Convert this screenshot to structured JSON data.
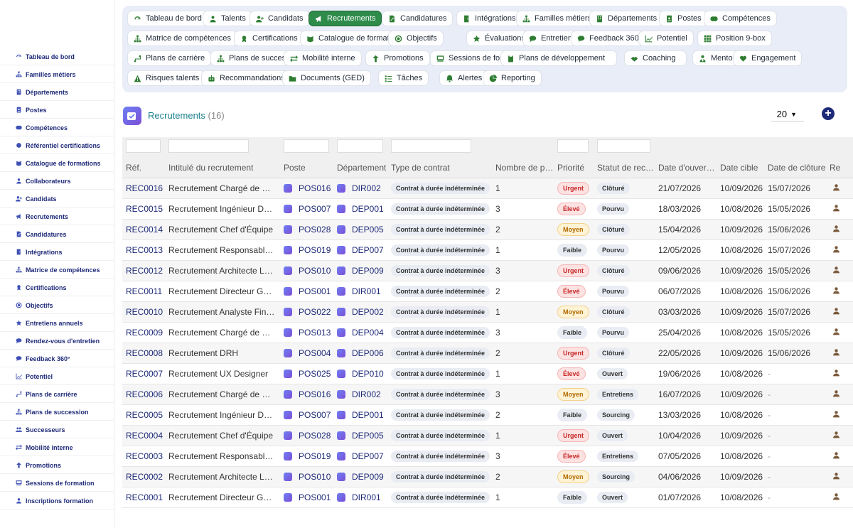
{
  "sidebar": {
    "items": [
      {
        "label": "Tableau de bord",
        "icon": "dashboard-icon"
      },
      {
        "label": "Familles métiers",
        "icon": "sitemap-icon"
      },
      {
        "label": "Départements",
        "icon": "building-icon"
      },
      {
        "label": "Postes",
        "icon": "id-badge-icon"
      },
      {
        "label": "Compétences",
        "icon": "brain-icon"
      },
      {
        "label": "Référentiel certifications",
        "icon": "certificate-icon"
      },
      {
        "label": "Catalogue de formations",
        "icon": "book-icon"
      },
      {
        "label": "Collaborateurs",
        "icon": "user-icon"
      },
      {
        "label": "Candidats",
        "icon": "user-plus-icon"
      },
      {
        "label": "Recrutements",
        "icon": "megaphone-icon"
      },
      {
        "label": "Candidatures",
        "icon": "file-signature-icon"
      },
      {
        "label": "Intégrations",
        "icon": "door-icon"
      },
      {
        "label": "Matrice de compétences",
        "icon": "sitemap-icon"
      },
      {
        "label": "Certifications",
        "icon": "award-icon"
      },
      {
        "label": "Objectifs",
        "icon": "target-icon"
      },
      {
        "label": "Entretiens annuels",
        "icon": "star-icon"
      },
      {
        "label": "Rendez-vous d'entretien",
        "icon": "chat-icon"
      },
      {
        "label": "Feedback 360°",
        "icon": "comment-icon"
      },
      {
        "label": "Potentiel",
        "icon": "chart-line-icon"
      },
      {
        "label": "Plans de carrière",
        "icon": "route-icon"
      },
      {
        "label": "Plans de succession",
        "icon": "sitemap-icon"
      },
      {
        "label": "Successeurs",
        "icon": "users-icon"
      },
      {
        "label": "Mobilité interne",
        "icon": "exchange-icon"
      },
      {
        "label": "Promotions",
        "icon": "arrow-up-icon"
      },
      {
        "label": "Sessions de formation",
        "icon": "chalkboard-icon"
      },
      {
        "label": "Inscriptions formation",
        "icon": "user-icon"
      }
    ]
  },
  "topnav": {
    "rows": [
      [
        {
          "label": "Tableau de bord",
          "icon": "dashboard-icon"
        },
        {
          "label": "Talents",
          "icon": "user-icon"
        },
        {
          "label": "Candidats",
          "icon": "user-plus-icon"
        },
        {
          "label": "Recrutements",
          "icon": "megaphone-icon",
          "active": true
        },
        {
          "label": "Candidatures",
          "icon": "file-signature-icon"
        },
        {
          "label": "Intégrations",
          "icon": "door-icon"
        },
        {
          "label": "Familles métiers",
          "icon": "sitemap-icon"
        },
        {
          "label": "Départements",
          "icon": "building-icon"
        },
        {
          "label": "Postes",
          "icon": "id-badge-icon"
        },
        {
          "label": "Compétences",
          "icon": "brain-icon"
        }
      ],
      [
        {
          "label": "Matrice de compétences",
          "icon": "sitemap-icon"
        },
        {
          "label": "Certifications",
          "icon": "award-icon"
        },
        {
          "label": "Catalogue de formations",
          "icon": "book-icon"
        },
        {
          "label": "Objectifs",
          "icon": "target-icon"
        },
        {
          "label": "Évaluations",
          "icon": "star-icon"
        },
        {
          "label": "Entretiens",
          "icon": "chat-icon"
        },
        {
          "label": "Feedback 360°",
          "icon": "comment-icon"
        },
        {
          "label": "Potentiel",
          "icon": "chart-line-icon"
        },
        {
          "label": "Position 9-box",
          "icon": "grid-icon"
        }
      ],
      [
        {
          "label": "Plans de carrière",
          "icon": "route-icon"
        },
        {
          "label": "Plans de succession",
          "icon": "sitemap-icon"
        },
        {
          "label": "Mobilité interne",
          "icon": "exchange-icon"
        },
        {
          "label": "Promotions",
          "icon": "arrow-up-icon"
        },
        {
          "label": "Sessions de formation",
          "icon": "chalkboard-icon"
        },
        {
          "label": "Plans de développement",
          "icon": "clipboard-icon"
        },
        {
          "label": "Coaching",
          "icon": "handshake-icon"
        },
        {
          "label": "Mentorat",
          "icon": "user-tie-icon"
        },
        {
          "label": "Engagement",
          "icon": "heart-icon"
        }
      ],
      [
        {
          "label": "Risques talents",
          "icon": "warning-icon"
        },
        {
          "label": "Recommandations IA",
          "icon": "robot-icon"
        },
        {
          "label": "Documents (GED)",
          "icon": "folder-icon"
        },
        {
          "label": "Tâches",
          "icon": "tasks-icon"
        },
        {
          "label": "Alertes RH",
          "icon": "bell-icon"
        },
        {
          "label": "Reporting",
          "icon": "pie-icon"
        }
      ]
    ]
  },
  "page": {
    "title": "Recrutements",
    "count": "(16)",
    "page_size": "20",
    "add_label": "+"
  },
  "table": {
    "headers": {
      "ref": "Réf.",
      "title": "Intitulé du recrutement",
      "poste": "Poste",
      "dept": "Département",
      "contract": "Type de contrat",
      "nb": "Nombre de p…",
      "prio": "Priorité",
      "status": "Statut de rec…",
      "open": "Date d'ouver…",
      "target": "Date cible",
      "close": "Date de clôture",
      "resp": "Re"
    },
    "rows": [
      {
        "ref": "REC0016",
        "title": "Recrutement Chargé de Co…",
        "poste": "POS016",
        "dept": "DIR002",
        "contract": "Contrat à durée indéterminée",
        "nb": "1",
        "prio": "Urgent",
        "prio_kind": "urgent",
        "status": "Clôturé",
        "open": "21/07/2026",
        "target": "10/09/2026",
        "close": "15/07/2026"
      },
      {
        "ref": "REC0015",
        "title": "Recrutement Ingénieur Dév…",
        "poste": "POS007",
        "dept": "DEP001",
        "contract": "Contrat à durée indéterminée",
        "nb": "3",
        "prio": "Élevé",
        "prio_kind": "eleve",
        "status": "Pourvu",
        "open": "18/03/2026",
        "target": "10/08/2026",
        "close": "15/05/2026"
      },
      {
        "ref": "REC0014",
        "title": "Recrutement Chef d'Équipe",
        "poste": "POS028",
        "dept": "DEP005",
        "contract": "Contrat à durée indéterminée",
        "nb": "2",
        "prio": "Moyen",
        "prio_kind": "moyen",
        "status": "Clôturé",
        "open": "15/04/2026",
        "target": "10/09/2026",
        "close": "15/06/2026"
      },
      {
        "ref": "REC0013",
        "title": "Recrutement Responsable …",
        "poste": "POS019",
        "dept": "DEP007",
        "contract": "Contrat à durée indéterminée",
        "nb": "1",
        "prio": "Faible",
        "prio_kind": "faible",
        "status": "Pourvu",
        "open": "12/05/2026",
        "target": "10/08/2026",
        "close": "15/07/2026"
      },
      {
        "ref": "REC0012",
        "title": "Recrutement Architecte Logi…",
        "poste": "POS010",
        "dept": "DEP009",
        "contract": "Contrat à durée indéterminée",
        "nb": "3",
        "prio": "Urgent",
        "prio_kind": "urgent",
        "status": "Clôturé",
        "open": "09/06/2026",
        "target": "10/09/2026",
        "close": "15/05/2026"
      },
      {
        "ref": "REC0011",
        "title": "Recrutement Directeur Gén…",
        "poste": "POS001",
        "dept": "DIR001",
        "contract": "Contrat à durée indéterminée",
        "nb": "2",
        "prio": "Élevé",
        "prio_kind": "eleve",
        "status": "Pourvu",
        "open": "06/07/2026",
        "target": "10/08/2026",
        "close": "15/06/2026"
      },
      {
        "ref": "REC0010",
        "title": "Recrutement Analyste Finan…",
        "poste": "POS022",
        "dept": "DEP002",
        "contract": "Contrat à durée indéterminée",
        "nb": "1",
        "prio": "Moyen",
        "prio_kind": "moyen",
        "status": "Clôturé",
        "open": "03/03/2026",
        "target": "10/09/2026",
        "close": "15/07/2026"
      },
      {
        "ref": "REC0009",
        "title": "Recrutement Chargé de Re…",
        "poste": "POS013",
        "dept": "DEP004",
        "contract": "Contrat à durée indéterminée",
        "nb": "3",
        "prio": "Faible",
        "prio_kind": "faible",
        "status": "Pourvu",
        "open": "25/04/2026",
        "target": "10/08/2026",
        "close": "15/05/2026"
      },
      {
        "ref": "REC0008",
        "title": "Recrutement DRH",
        "poste": "POS004",
        "dept": "DEP006",
        "contract": "Contrat à durée indéterminée",
        "nb": "2",
        "prio": "Urgent",
        "prio_kind": "urgent",
        "status": "Clôturé",
        "open": "22/05/2026",
        "target": "10/09/2026",
        "close": "15/06/2026"
      },
      {
        "ref": "REC0007",
        "title": "Recrutement UX Designer",
        "poste": "POS025",
        "dept": "DEP010",
        "contract": "Contrat à durée indéterminée",
        "nb": "1",
        "prio": "Élevé",
        "prio_kind": "eleve",
        "status": "Ouvert",
        "open": "19/06/2026",
        "target": "10/08/2026",
        "close": "-"
      },
      {
        "ref": "REC0006",
        "title": "Recrutement Chargé de Co…",
        "poste": "POS016",
        "dept": "DIR002",
        "contract": "Contrat à durée indéterminée",
        "nb": "3",
        "prio": "Moyen",
        "prio_kind": "moyen",
        "status": "Entretiens",
        "open": "16/07/2026",
        "target": "10/09/2026",
        "close": "-"
      },
      {
        "ref": "REC0005",
        "title": "Recrutement Ingénieur Dév…",
        "poste": "POS007",
        "dept": "DEP001",
        "contract": "Contrat à durée indéterminée",
        "nb": "2",
        "prio": "Faible",
        "prio_kind": "faible",
        "status": "Sourcing",
        "open": "13/03/2026",
        "target": "10/08/2026",
        "close": "-"
      },
      {
        "ref": "REC0004",
        "title": "Recrutement Chef d'Équipe",
        "poste": "POS028",
        "dept": "DEP005",
        "contract": "Contrat à durée indéterminée",
        "nb": "1",
        "prio": "Urgent",
        "prio_kind": "urgent",
        "status": "Ouvert",
        "open": "10/04/2026",
        "target": "10/09/2026",
        "close": "-"
      },
      {
        "ref": "REC0003",
        "title": "Recrutement Responsable …",
        "poste": "POS019",
        "dept": "DEP007",
        "contract": "Contrat à durée indéterminée",
        "nb": "3",
        "prio": "Élevé",
        "prio_kind": "eleve",
        "status": "Entretiens",
        "open": "07/05/2026",
        "target": "10/08/2026",
        "close": "-"
      },
      {
        "ref": "REC0002",
        "title": "Recrutement Architecte Logi…",
        "poste": "POS010",
        "dept": "DEP009",
        "contract": "Contrat à durée indéterminée",
        "nb": "2",
        "prio": "Moyen",
        "prio_kind": "moyen",
        "status": "Sourcing",
        "open": "04/06/2026",
        "target": "10/09/2026",
        "close": "-"
      },
      {
        "ref": "REC0001",
        "title": "Recrutement Directeur Gén…",
        "poste": "POS001",
        "dept": "DIR001",
        "contract": "Contrat à durée indéterminée",
        "nb": "1",
        "prio": "Faible",
        "prio_kind": "faible",
        "status": "Ouvert",
        "open": "01/07/2026",
        "target": "10/08/2026",
        "close": "-"
      }
    ]
  },
  "colors": {
    "accent_green": "#2e8b4a",
    "nav_bg": "#e9edf8",
    "link_navy": "#1e2a78",
    "title_teal": "#1a7f8e",
    "urgent_red": "#c62828",
    "moyen_amber": "#b26a00"
  }
}
